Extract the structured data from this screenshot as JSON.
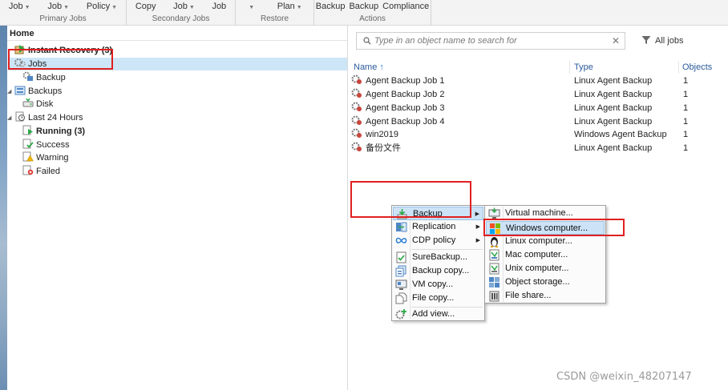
{
  "ribbon": {
    "groups": [
      {
        "label": "Primary Jobs",
        "buttons": [
          {
            "text": "Job",
            "dropdown": true
          },
          {
            "text": "Job",
            "dropdown": true
          },
          {
            "text": "Policy",
            "dropdown": true
          }
        ]
      },
      {
        "label": "Secondary Jobs",
        "buttons": [
          {
            "text": "Copy",
            "dropdown": false
          },
          {
            "text": "Job",
            "dropdown": true
          },
          {
            "text": "Job",
            "dropdown": false
          }
        ]
      },
      {
        "label": "Restore",
        "buttons": [
          {
            "text": "",
            "dropdown": true
          },
          {
            "text": "Plan",
            "dropdown": true
          }
        ]
      },
      {
        "label": "Actions",
        "buttons": [
          {
            "text": "Backup",
            "dropdown": false
          },
          {
            "text": "Backup",
            "dropdown": false
          },
          {
            "text": "Compliance",
            "dropdown": false
          }
        ]
      }
    ]
  },
  "tree": {
    "title": "Home",
    "items": [
      {
        "label": "Instant Recovery (3)",
        "bold": true,
        "icon": "instant-recovery-icon"
      },
      {
        "label": "Jobs",
        "bold": false,
        "icon": "jobs-icon",
        "selected": true
      },
      {
        "label": "Backup",
        "bold": false,
        "icon": "backup-icon"
      },
      {
        "label": "Backups",
        "bold": false,
        "icon": "backups-icon"
      },
      {
        "label": "Disk",
        "bold": false,
        "icon": "disk-icon"
      },
      {
        "label": "Last 24 Hours",
        "bold": false,
        "icon": "last-24-hours-icon"
      },
      {
        "label": "Running (3)",
        "bold": true,
        "icon": "running-icon"
      },
      {
        "label": "Success",
        "bold": false,
        "icon": "success-icon"
      },
      {
        "label": "Warning",
        "bold": false,
        "icon": "warning-icon"
      },
      {
        "label": "Failed",
        "bold": false,
        "icon": "failed-icon"
      }
    ]
  },
  "search": {
    "placeholder": "Type in an object name to search for",
    "clear": "✕"
  },
  "filter": {
    "label": "All jobs"
  },
  "grid": {
    "columns": [
      "Name",
      "Type",
      "Objects"
    ],
    "sort_arrow": "↑",
    "rows": [
      {
        "name": "Agent Backup Job 1",
        "type": "Linux Agent Backup",
        "objects": "1"
      },
      {
        "name": "Agent Backup Job 2",
        "type": "Linux Agent Backup",
        "objects": "1"
      },
      {
        "name": "Agent Backup Job 3",
        "type": "Linux Agent Backup",
        "objects": "1"
      },
      {
        "name": "Agent Backup Job 4",
        "type": "Linux Agent Backup",
        "objects": "1"
      },
      {
        "name": "win2019",
        "type": "Windows Agent Backup",
        "objects": "1"
      },
      {
        "name": "备份文件",
        "type": "Linux Agent Backup",
        "objects": "1"
      }
    ]
  },
  "context_menu": {
    "items": [
      {
        "label": "Backup",
        "icon": "backup-job-icon",
        "submenu": true,
        "highlighted": true
      },
      {
        "label": "Replication",
        "icon": "replication-icon",
        "submenu": true
      },
      {
        "label": "CDP policy",
        "icon": "cdp-policy-icon",
        "submenu": true
      },
      {
        "label": "SureBackup...",
        "icon": "surebackup-icon",
        "submenu": false
      },
      {
        "label": "Backup copy...",
        "icon": "backup-copy-icon",
        "submenu": false
      },
      {
        "label": "VM copy...",
        "icon": "vm-copy-icon",
        "submenu": false
      },
      {
        "label": "File copy...",
        "icon": "file-copy-icon",
        "submenu": false
      },
      {
        "label": "Add view...",
        "icon": "add-view-icon",
        "submenu": false
      }
    ],
    "submenu_arrow": "▶"
  },
  "submenu": {
    "items": [
      {
        "label": "Virtual machine...",
        "icon": "virtual-machine-icon"
      },
      {
        "label": "Windows computer...",
        "icon": "windows-computer-icon",
        "highlighted": true
      },
      {
        "label": "Linux computer...",
        "icon": "linux-computer-icon"
      },
      {
        "label": "Mac computer...",
        "icon": "mac-computer-icon"
      },
      {
        "label": "Unix computer...",
        "icon": "unix-computer-icon"
      },
      {
        "label": "Object storage...",
        "icon": "object-storage-icon"
      },
      {
        "label": "File share...",
        "icon": "file-share-icon"
      }
    ]
  },
  "watermark": "CSDN @weixin_48207147",
  "colors": {
    "accent": "#2a5b9b",
    "selection": "#cde6f7",
    "menu_highlight": "#cce2f6",
    "annotation_red": "#e02020"
  }
}
